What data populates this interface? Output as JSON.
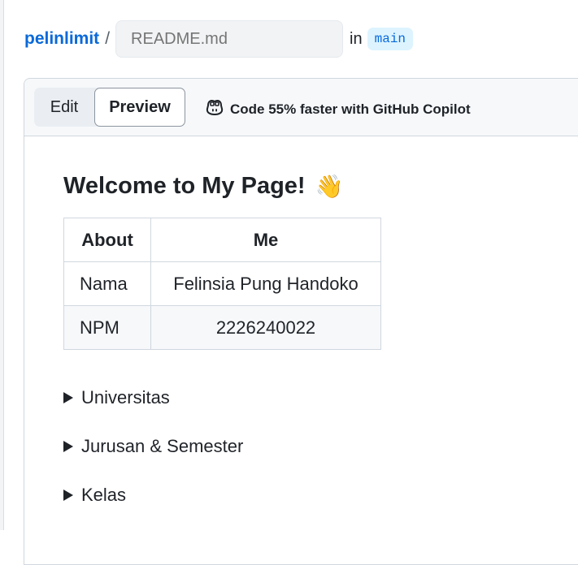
{
  "breadcrumb": {
    "owner": "pelinlimit",
    "separator": "/",
    "filename_placeholder": "README.md",
    "in_label": "in",
    "branch": "main"
  },
  "toolbar": {
    "edit_label": "Edit",
    "preview_label": "Preview",
    "copilot_text": "Code 55% faster with GitHub Copilot"
  },
  "preview": {
    "heading": "Welcome to My Page!",
    "heading_emoji": "👋",
    "table": {
      "headers": [
        "About",
        "Me"
      ],
      "rows": [
        [
          "Nama",
          "Felinsia Pung Handoko"
        ],
        [
          "NPM",
          "2226240022"
        ]
      ]
    },
    "details": [
      "Universitas",
      "Jurusan & Semester",
      "Kelas"
    ]
  },
  "colors": {
    "link": "#0969da",
    "branch_bg": "#ddf4ff",
    "border": "#d0d7de",
    "toolbar_bg": "#f6f8fa"
  },
  "icons": {
    "copilot": "copilot-icon",
    "disclosure": "triangle-right-icon"
  }
}
